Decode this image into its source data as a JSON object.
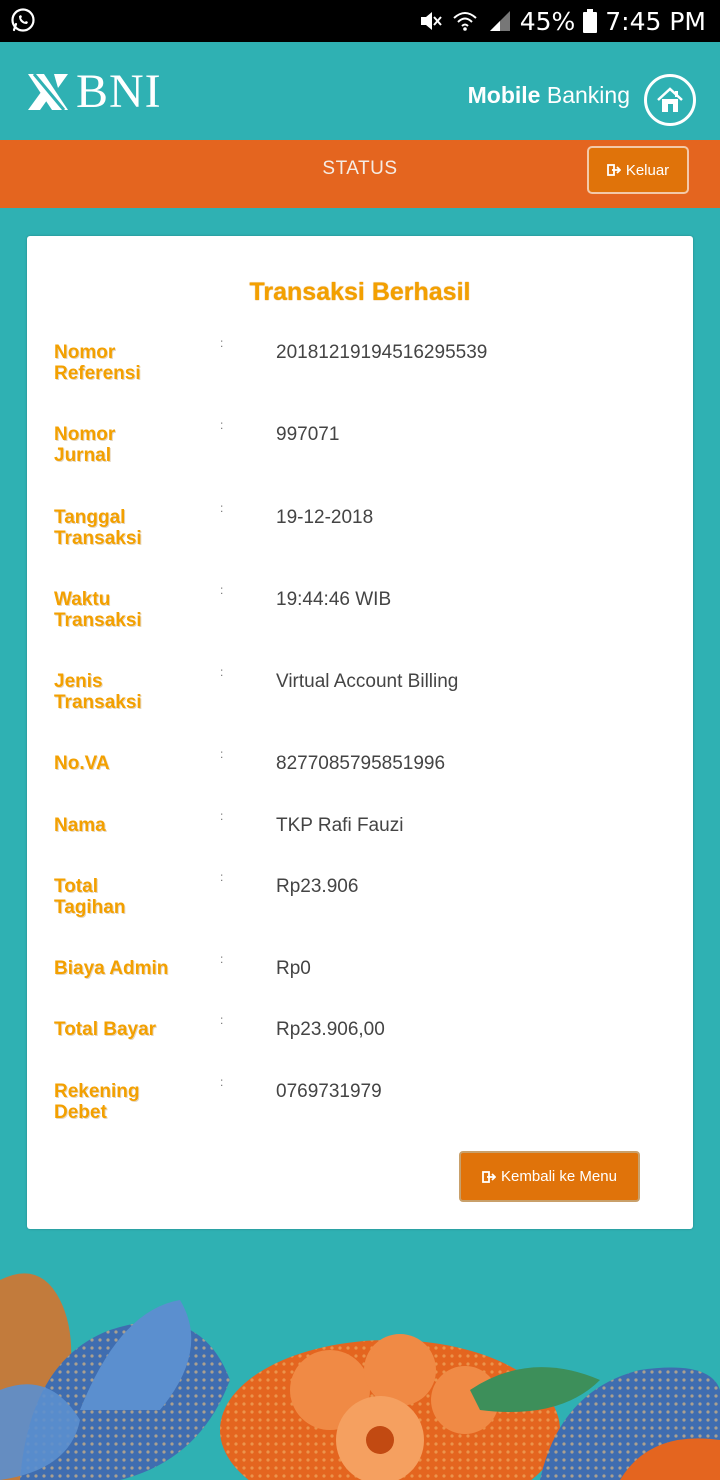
{
  "status_bar": {
    "battery": "45%",
    "time": "7:45 PM"
  },
  "header": {
    "logo_text": "BNI",
    "mobile_label_bold": "Mobile",
    "mobile_label_rest": "Banking"
  },
  "nav": {
    "title": "STATUS",
    "logout_label": "Keluar"
  },
  "receipt": {
    "title": "Transaksi Berhasil",
    "colon": ":",
    "rows": [
      {
        "label": "Nomor\nReferensi",
        "value": "20181219194516295539"
      },
      {
        "label": "Nomor\nJurnal",
        "value": "997071"
      },
      {
        "label": "Tanggal\nTransaksi",
        "value": "19-12-2018"
      },
      {
        "label": "Waktu\nTransaksi",
        "value": "19:44:46 WIB"
      },
      {
        "label": "Jenis\nTransaksi",
        "value": "Virtual Account Billing"
      },
      {
        "label": "No.VA",
        "value": "8277085795851996"
      },
      {
        "label": "Nama",
        "value": "TKP Rafi Fauzi"
      },
      {
        "label": "Total\nTagihan",
        "value": "Rp23.906"
      },
      {
        "label": "Biaya Admin",
        "value": "Rp0"
      },
      {
        "label": "Total Bayar",
        "value": "Rp23.906,00"
      },
      {
        "label": "Rekening\nDebet",
        "value": "0769731979"
      }
    ],
    "back_label": "Kembali ke Menu"
  },
  "colors": {
    "teal": "#2fb1b3",
    "orange_bar": "#e4651f",
    "button_orange": "#e0730a",
    "label_orange": "#f3a000"
  }
}
